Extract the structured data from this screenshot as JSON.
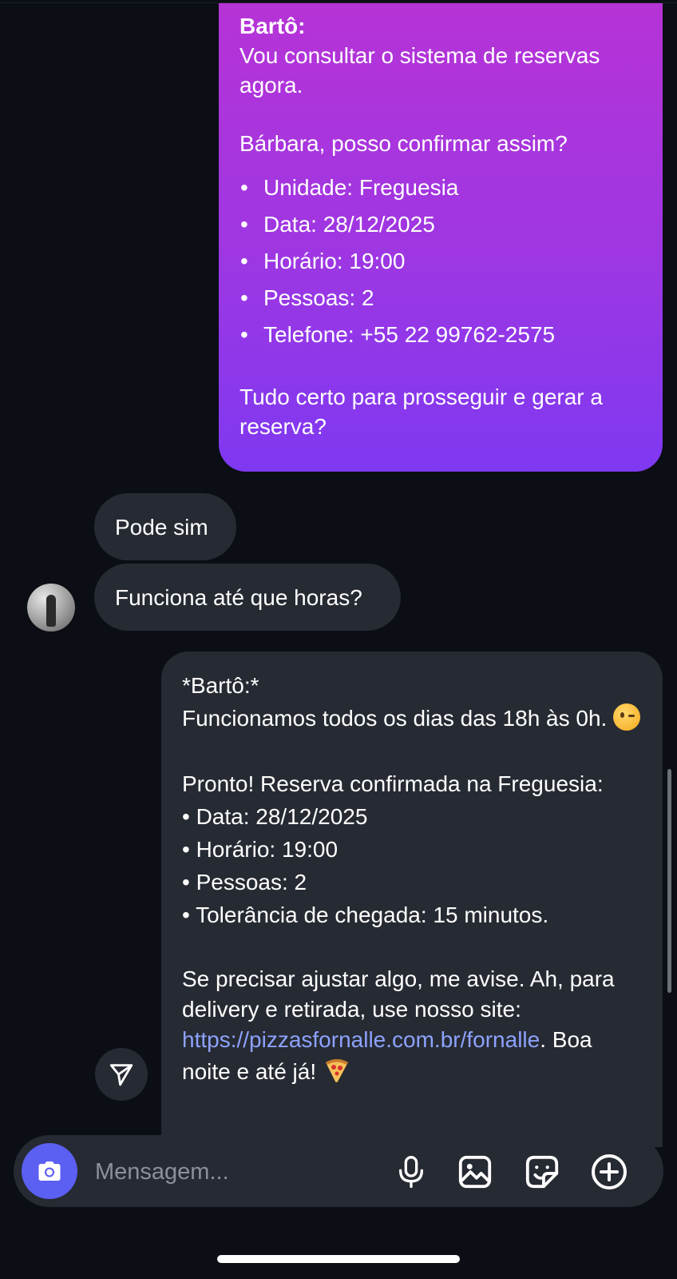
{
  "messages": {
    "bot_summary": {
      "sender": "Bartô:",
      "line1": "Vou consultar o sistema de reservas agora.",
      "line2": "Bárbara, posso confirmar assim?",
      "items": [
        "Unidade: Freguesia",
        "Data: 28/12/2025",
        "Horário: 19:00",
        "Pessoas: 2",
        "Telefone: +55 22 99762-2575"
      ],
      "line3": "Tudo certo para prosseguir e gerar a reserva?"
    },
    "user_reply_1": "Pode sim",
    "user_reply_2": "Funciona até que horas?",
    "bot_confirmation": {
      "sender": "*Bartô:*",
      "hours": "Funcionamos todos os dias das 18h às 0h.",
      "heading": "Pronto! Reserva confirmada na Freguesia:",
      "items": [
        "• Data: 28/12/2025",
        "• Horário: 19:00",
        "• Pessoas: 2",
        "• Tolerância de chegada: 15 minutos."
      ],
      "closing_before_link": "Se precisar ajustar algo, me avise. Ah, para delivery e retirada, use nosso site:",
      "link": "https://pizzasfornalle.com.br/fornalle",
      "closing_after_link": ". Boa noite e até já!"
    }
  },
  "composer": {
    "placeholder": "Mensagem...",
    "icons": [
      "camera-icon",
      "microphone-icon",
      "gallery-icon",
      "sticker-icon",
      "add-circle-icon"
    ]
  },
  "icons": {
    "share": "send-icon",
    "emoji_hours": "winking-face-emoji",
    "emoji_closing": "pizza-emoji"
  },
  "colors": {
    "background": "#0b0e14",
    "bubble_incoming": "#262a32",
    "bubble_outgoing_top": "#b633d6",
    "bubble_outgoing_bottom": "#7f38f1",
    "link": "#8da2ff",
    "camera_button": "#5b5ff2"
  }
}
